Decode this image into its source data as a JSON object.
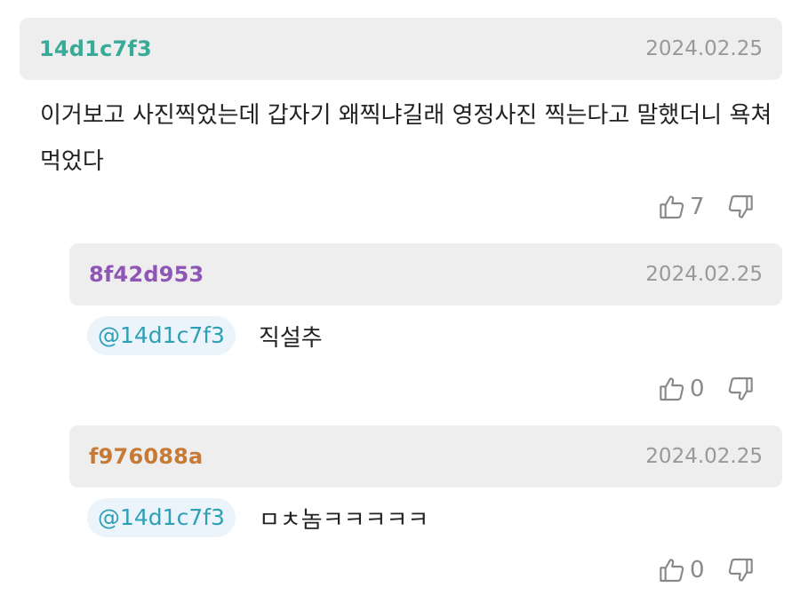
{
  "colors": {
    "main_author": "#3aaa98",
    "reply1_author": "#8e56b5",
    "reply2_author": "#c67a35",
    "mention": "#2f9fb5",
    "header_bg": "#eeeeee",
    "date": "#999999"
  },
  "icons": {
    "upvote": "thumbs-up-outline",
    "downvote": "thumbs-down-outline"
  },
  "main_comment": {
    "author": "14d1c7f3",
    "date": "2024.02.25",
    "text": "이거보고 사진찍었는데 갑자기 왜찍냐길래 영정사진 찍는다고 말했더니 욕쳐먹었다",
    "upvotes": "7"
  },
  "replies": [
    {
      "author": "8f42d953",
      "date": "2024.02.25",
      "mention": "@14d1c7f3",
      "text": "직설추",
      "upvotes": "0"
    },
    {
      "author": "f976088a",
      "date": "2024.02.25",
      "mention": "@14d1c7f3",
      "text": "ㅁㅊ놈ㅋㅋㅋㅋㅋ",
      "upvotes": "0"
    }
  ]
}
